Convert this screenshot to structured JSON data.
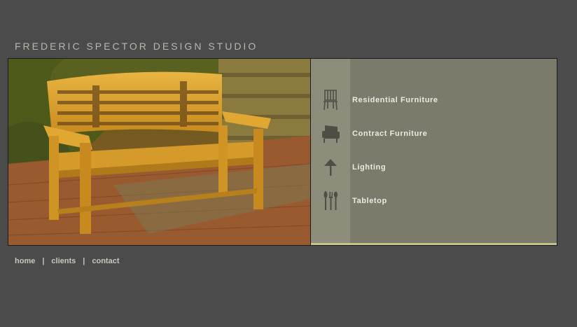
{
  "site": {
    "title": "FREDERIC SPECTOR DESIGN STUDIO"
  },
  "hero": {
    "image_icon": "garden-bench-photo"
  },
  "menu": {
    "items": [
      {
        "label": "Residential Furniture",
        "icon": "chair-icon"
      },
      {
        "label": "Contract Furniture",
        "icon": "armchair-icon"
      },
      {
        "label": "Lighting",
        "icon": "lamp-icon"
      },
      {
        "label": "Tabletop",
        "icon": "cutlery-icon"
      }
    ]
  },
  "footer": {
    "links": [
      {
        "label": "home"
      },
      {
        "label": "clients"
      },
      {
        "label": "contact"
      }
    ],
    "separator": "|"
  },
  "colors": {
    "background": "#4b4b4b",
    "menu_panel": "#7b7a6b",
    "menu_strip": "#8e8c7b",
    "accent_bar": "#c8c28c",
    "title_text": "#b9b7ac"
  }
}
